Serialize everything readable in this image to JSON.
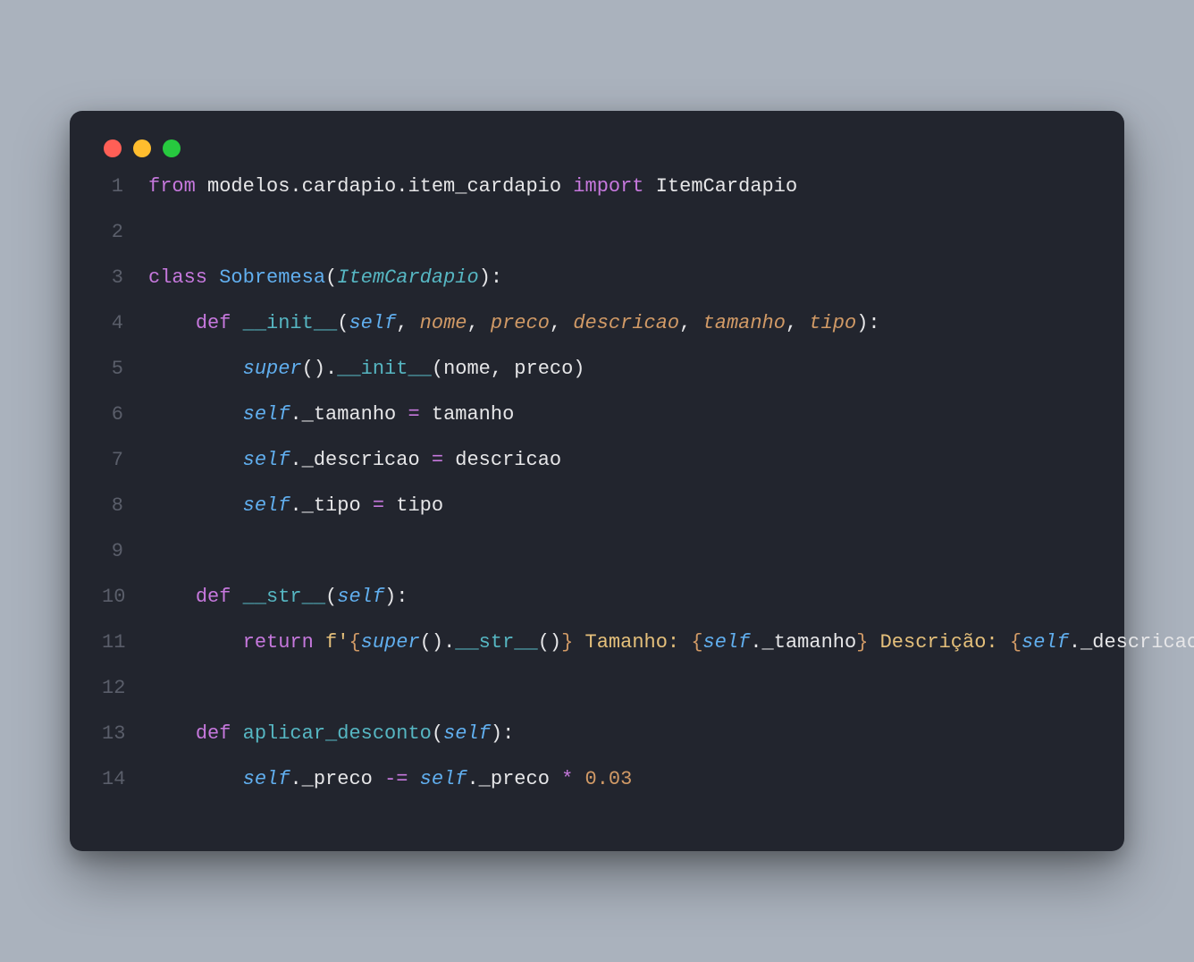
{
  "window": {
    "traffic": {
      "close": "close",
      "min": "minimize",
      "max": "zoom"
    }
  },
  "code": {
    "line_numbers": [
      "1",
      "2",
      "3",
      "4",
      "5",
      "6",
      "7",
      "8",
      "9",
      "10",
      "11",
      "12",
      "13",
      "14"
    ],
    "l1": {
      "from": "from",
      "module": "modelos.cardapio.item_cardapio",
      "import": "import",
      "name": "ItemCardapio"
    },
    "l3": {
      "class_kw": "class",
      "name": "Sobremesa",
      "lparen": "(",
      "base": "ItemCardapio",
      "rparen": "):"
    },
    "l4": {
      "def": "def",
      "name": "__init__",
      "lparen": "(",
      "self": "self",
      "c1": ", ",
      "p1": "nome",
      "c2": ", ",
      "p2": "preco",
      "c3": ", ",
      "p3": "descricao",
      "c4": ", ",
      "p4": "tamanho",
      "c5": ", ",
      "p5": "tipo",
      "rparen": "):"
    },
    "l5": {
      "super": "super",
      "call": "().",
      "dunder": "__init__",
      "args": "(nome, preco)"
    },
    "l6": {
      "self": "self",
      "attr": "._tamanho ",
      "eq": "=",
      "val": " tamanho"
    },
    "l7": {
      "self": "self",
      "attr": "._descricao ",
      "eq": "=",
      "val": " descricao"
    },
    "l8": {
      "self": "self",
      "attr": "._tipo ",
      "eq": "=",
      "val": " tipo"
    },
    "l10": {
      "def": "def",
      "name": "__str__",
      "lparen": "(",
      "self": "self",
      "rparen": "):"
    },
    "l11": {
      "return": "return",
      "fpre": " f'",
      "br1o": "{",
      "super": "super",
      "call": "().",
      "dunder": "__str__",
      "args": "()",
      "br1c": "}",
      "s1": " Tamanho: ",
      "br2o": "{",
      "self1": "self",
      "a1": "._tamanho",
      "br2c": "}",
      "s2": " Descrição: ",
      "br3o": "{",
      "self2": "self",
      "a2": "._descricao",
      "br3c": "}",
      "q": "'"
    },
    "l13": {
      "def": "def",
      "name": "aplicar_desconto",
      "lparen": "(",
      "self": "self",
      "rparen": "):"
    },
    "l14": {
      "self1": "self",
      "a1": "._preco ",
      "opeq": "-=",
      "self2": " self",
      "a2": "._preco ",
      "mul": "*",
      "num": " 0.03"
    },
    "indent": {
      "i1": "    ",
      "i2": "        "
    }
  }
}
